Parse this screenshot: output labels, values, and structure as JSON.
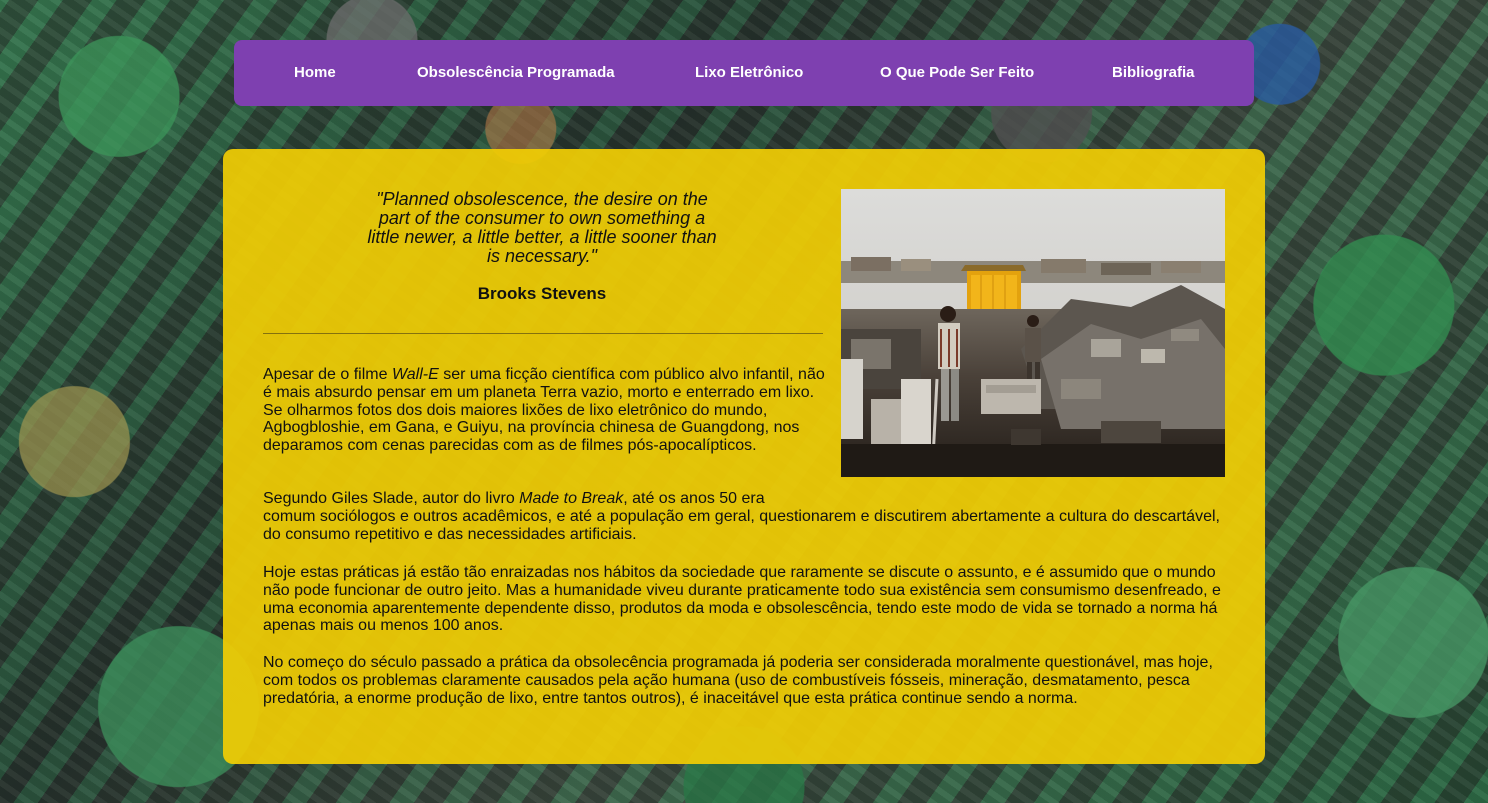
{
  "nav": {
    "items": [
      {
        "label": "Home"
      },
      {
        "label": "Obsolescência Programada"
      },
      {
        "label": "Lixo Eletrônico"
      },
      {
        "label": "O Que Pode Ser Feito"
      },
      {
        "label": "Bibliografia"
      }
    ]
  },
  "quote": {
    "text": "\"Planned obsolescence, the desire on the part of the consumer to own something a little newer, a little better, a little sooner than is necessary.\"",
    "author": "Brooks Stevens"
  },
  "photo": {
    "icon": "e-waste-dump-photo"
  },
  "article": {
    "p1_a": "Apesar de o filme ",
    "p1_film": "Wall-E",
    "p1_b": " ser uma ficção científica com público alvo infantil, não é mais absurdo pensar em um planeta Terra vazio, morto e enterrado em lixo. Se olharmos fotos dos dois maiores lixões de lixo eletrônico do mundo, Agbogbloshie, em Gana, e Guiyu, na província chinesa de Guangdong, nos deparamos com cenas parecidas com as de filmes pós-apocalípticos.",
    "p2_a": "Segundo Giles Slade, autor do livro ",
    "p2_book": "Made to Break",
    "p2_b1": ", até os anos 50 era",
    "p2_b2": "comum sociólogos e outros acadêmicos, e até a população em geral, questionarem e discutirem abertamente a cultura do descartável, do consumo repetitivo e das necessidades artificiais.",
    "p3": "Hoje estas práticas já estão tão enraizadas nos hábitos da sociedade que raramente se discute o assunto, e é assumido que o mundo não pode funcionar de outro jeito. Mas a humanidade viveu durante praticamente todo sua existência sem consumismo desenfreado, e uma economia aparentemente dependente disso, produtos da moda e obsolescência, tendo este modo de vida se tornado a norma há apenas mais ou menos 100 anos.",
    "p4": "No começo do século passado a prática da obsolecência programada já poderia ser considerada moralmente questionável, mas hoje, com todos os problemas claramente causados pela ação humana (uso de combustíveis fósseis, mineração, desmatamento, pesca predatória, a enorme produção de lixo, entre tantos outros), é inaceitável que esta prática continue sendo a norma."
  },
  "colors": {
    "nav_bg": "#7e40b0",
    "panel_bg": "#f0cc04"
  }
}
